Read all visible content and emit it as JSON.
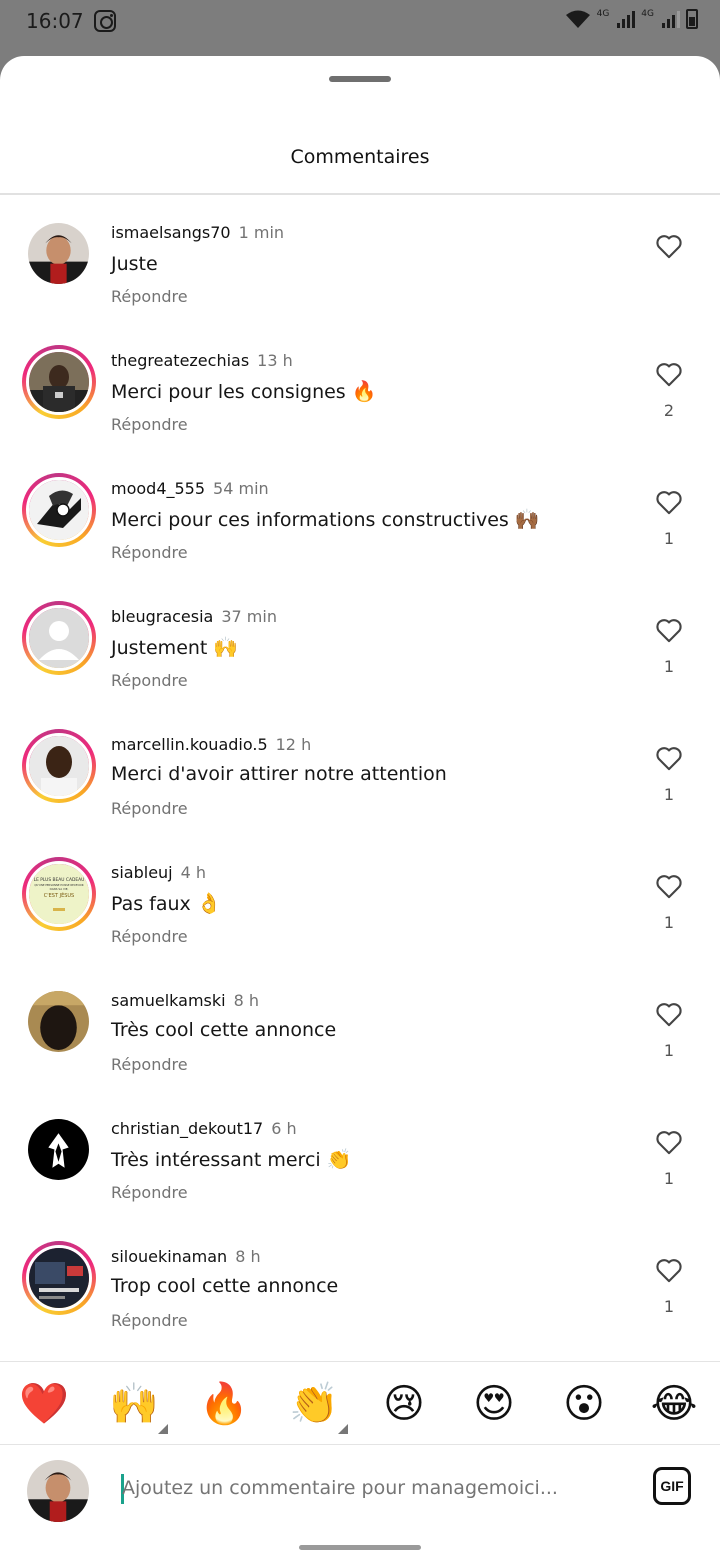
{
  "status_bar": {
    "time": "16:07",
    "network_1": "4G",
    "network_2": "4G"
  },
  "sheet": {
    "title": "Commentaires"
  },
  "comments": [
    {
      "username": "ismaelsangs70",
      "time": "1 min",
      "text": "Juste",
      "emoji": "",
      "reply_label": "Répondre",
      "likes": ""
    },
    {
      "username": "thegreatezechias",
      "time": "13 h",
      "text": "Merci pour les consignes",
      "emoji": "🔥",
      "reply_label": "Répondre",
      "likes": "2"
    },
    {
      "username": "mood4_555",
      "time": "54 min",
      "text": "Merci pour ces informations constructives",
      "emoji": "🙌🏾",
      "reply_label": "Répondre",
      "likes": "1"
    },
    {
      "username": "bleugracesia",
      "time": "37 min",
      "text": "Justement",
      "emoji": "🙌",
      "reply_label": "Répondre",
      "likes": "1"
    },
    {
      "username": "marcellin.kouadio.5",
      "time": "12 h",
      "text": "Merci d'avoir attirer notre attention",
      "emoji": "",
      "reply_label": "Répondre",
      "likes": "1"
    },
    {
      "username": "siableuj",
      "time": "4 h",
      "text": "Pas faux",
      "emoji": "👌",
      "reply_label": "Répondre",
      "likes": "1"
    },
    {
      "username": "samuelkamski",
      "time": "8 h",
      "text": "Très cool cette annonce",
      "emoji": "",
      "reply_label": "Répondre",
      "likes": "1"
    },
    {
      "username": "christian_dekout17",
      "time": "6 h",
      "text": "Très intéressant merci",
      "emoji": "👏",
      "reply_label": "Répondre",
      "likes": "1"
    },
    {
      "username": "silouekinaman",
      "time": "8 h",
      "text": "Trop cool cette annonce",
      "emoji": "",
      "reply_label": "Répondre",
      "likes": "1"
    }
  ],
  "avatar_images": {
    "siableuj_poster": {
      "line1": "LE PLUS BEAU CADEAU",
      "line2": "QU'UNE PERSONNE PUISSE RECEVOIR",
      "line3": "DANS SA VIE,",
      "line4": "C'EST JÉSUS"
    }
  },
  "reactions": [
    "❤️",
    "🙌",
    "🔥",
    "👏",
    "😢",
    "😍",
    "😮",
    "😂"
  ],
  "composer": {
    "placeholder": "Ajoutez un commentaire pour managemoici...",
    "gif_label": "GIF"
  },
  "colors": {
    "story_ring": "#ee2a7b",
    "caret": "#1aa28c",
    "secondary_text": "#737373"
  }
}
